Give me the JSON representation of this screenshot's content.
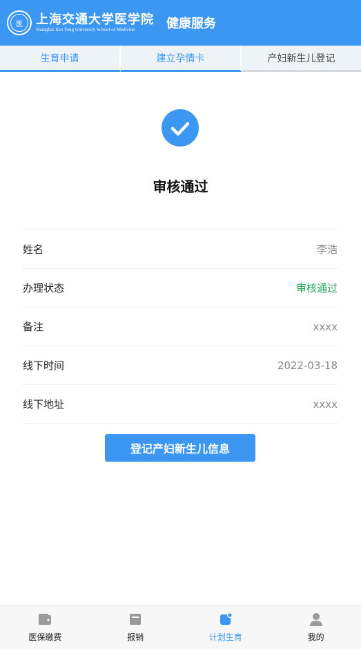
{
  "header": {
    "logo_cn": "上海交通大学医学院",
    "logo_en": "Shanghai Jiao Tong University School of Medicine",
    "title": "健康服务"
  },
  "tabs": [
    {
      "label": "生育申请"
    },
    {
      "label": "建立孕情卡"
    },
    {
      "label": "产妇新生儿登记"
    }
  ],
  "status": {
    "title": "审核通过",
    "icon": "check-circle-icon",
    "color": "#3b97f2"
  },
  "info": [
    {
      "label": "姓名",
      "value": "李浩"
    },
    {
      "label": "办理状态",
      "value": "审核通过"
    },
    {
      "label": "备注",
      "value": "xxxx"
    },
    {
      "label": "线下时间",
      "value": "2022-03-18"
    },
    {
      "label": "线下地址",
      "value": "xxxx"
    }
  ],
  "action_button": {
    "label": "登记产妇新生儿信息"
  },
  "bottom_nav": [
    {
      "label": "医保缴费",
      "icon": "wallet-icon"
    },
    {
      "label": "报销",
      "icon": "inbox-icon"
    },
    {
      "label": "计划生育",
      "icon": "plan-icon"
    },
    {
      "label": "我的",
      "icon": "person-icon"
    }
  ],
  "colors": {
    "accent": "#3b97f2",
    "success": "#27a658"
  }
}
